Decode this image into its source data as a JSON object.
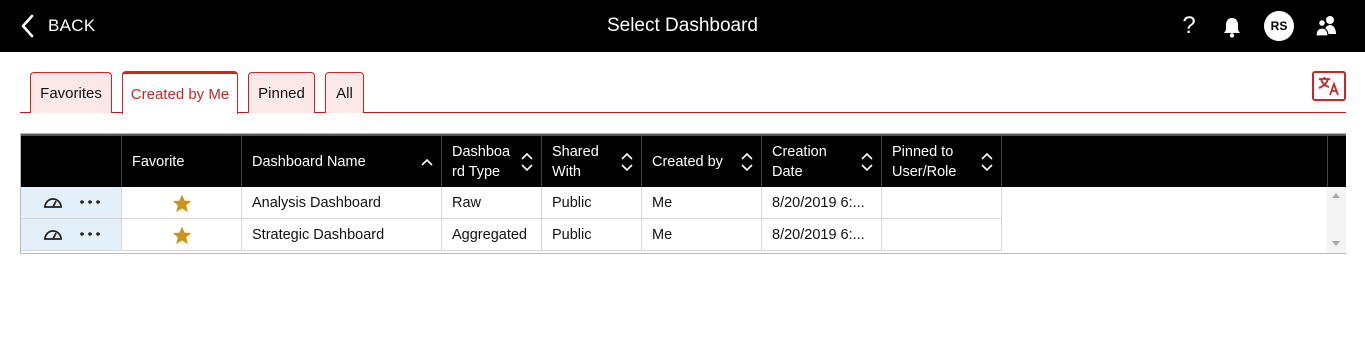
{
  "header": {
    "back_label": "BACK",
    "title": "Select Dashboard",
    "help_glyph": "?",
    "avatar_initials": "RS"
  },
  "tabs": [
    {
      "label": "Favorites",
      "active": false
    },
    {
      "label": "Created by Me",
      "active": true
    },
    {
      "label": "Pinned",
      "active": false
    },
    {
      "label": "All",
      "active": false
    }
  ],
  "grid": {
    "columns": [
      {
        "label": ""
      },
      {
        "label": "Favorite"
      },
      {
        "label": "Dashboard Name"
      },
      {
        "label": "Dashboa rd Type"
      },
      {
        "label": "Shared With"
      },
      {
        "label": "Created by"
      },
      {
        "label": "Creation Date"
      },
      {
        "label": "Pinned to User/Role"
      }
    ],
    "header_lines": {
      "type": [
        "Dashboa",
        "rd Type"
      ],
      "shared": [
        "Shared",
        "With"
      ],
      "date": [
        "Creation",
        "Date"
      ],
      "pinned": [
        "Pinned to",
        "User/Role"
      ]
    },
    "rows": [
      {
        "favorite": true,
        "name": "Analysis Dashboard",
        "type": "Raw",
        "shared": "Public",
        "created_by": "Me",
        "date": "8/20/2019 6:...",
        "pinned": ""
      },
      {
        "favorite": true,
        "name": "Strategic Dashboard",
        "type": "Aggregated",
        "shared": "Public",
        "created_by": "Me",
        "date": "8/20/2019 6:...",
        "pinned": ""
      }
    ]
  },
  "colors": {
    "accent": "#c62828",
    "tab_bg": "#fde8e8",
    "row_icon_bg": "#e3f0fa",
    "star": "#c8961c"
  },
  "icons": {
    "back": "chevron-left-icon",
    "bell": "bell-icon",
    "users": "users-icon",
    "translate": "translate-icon",
    "dashboard": "speedometer-icon",
    "more": "more-horizontal-icon",
    "star": "star-icon"
  }
}
